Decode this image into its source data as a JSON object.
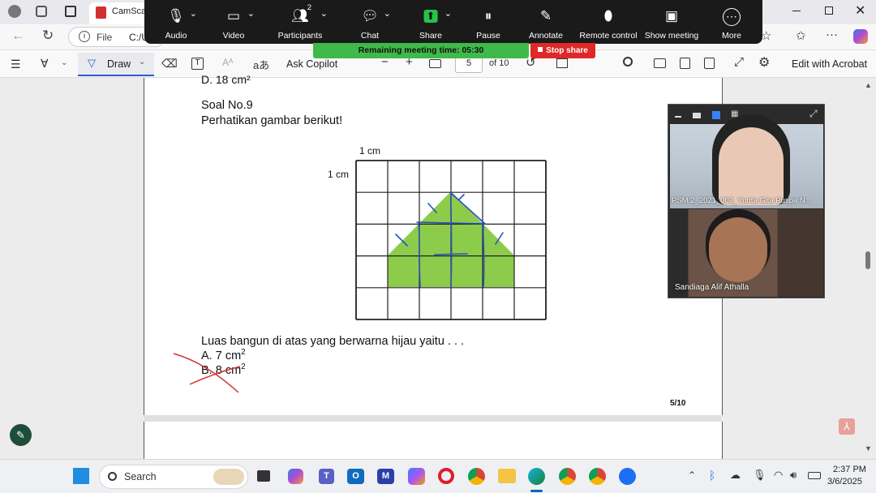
{
  "browser": {
    "tab_title": "CamScan",
    "address_prefix": "File",
    "address_text": "C:/U"
  },
  "zoom": {
    "items": [
      {
        "label": "Audio",
        "icon": "mic-icon"
      },
      {
        "label": "Video",
        "icon": "camera-icon"
      },
      {
        "label": "Participants",
        "icon": "participants-icon",
        "count": "2"
      },
      {
        "label": "Chat",
        "icon": "chat-icon"
      },
      {
        "label": "Share",
        "icon": "share-icon"
      },
      {
        "label": "Pause",
        "icon": "pause-icon"
      },
      {
        "label": "Annotate",
        "icon": "pen-icon"
      },
      {
        "label": "Remote control",
        "icon": "mouse-icon"
      },
      {
        "label": "Show meeting",
        "icon": "screen-icon"
      },
      {
        "label": "More",
        "icon": "more-icon"
      }
    ],
    "timer_text": "Remaining meeting time: 05:30",
    "stop_share": "Stop share"
  },
  "pdf_toolbar": {
    "draw": "Draw",
    "ask_copilot": "Ask Copilot",
    "page_current": "5",
    "page_total": "of 10",
    "edit_acrobat": "Edit with Acrobat"
  },
  "document": {
    "prev_answer": "D. 18 cm²",
    "question_no": "Soal No.9",
    "instruction": "Perhatikan gambar berikut!",
    "label_top": "1 cm",
    "label_left": "1 cm",
    "question": "Luas bangun di atas yang berwarna hijau yaitu . . .",
    "option_a": "A. 7 cm",
    "option_b": "B. 8 cm",
    "sup": "2",
    "page_number": "5/10"
  },
  "participants": [
    {
      "name": "PSM 2_2021_002_Yurita Gita Puspa N..."
    },
    {
      "name": "Sandiaga Alif Athalla"
    }
  ],
  "taskbar": {
    "search": "Search",
    "time": "2:37 PM",
    "date": "3/6/2025"
  },
  "colors": {
    "shape_green": "#8dcc4a",
    "zoom_bar": "#1a1a1a",
    "timer_green": "#3fb94a",
    "stop_red": "#e02828"
  }
}
